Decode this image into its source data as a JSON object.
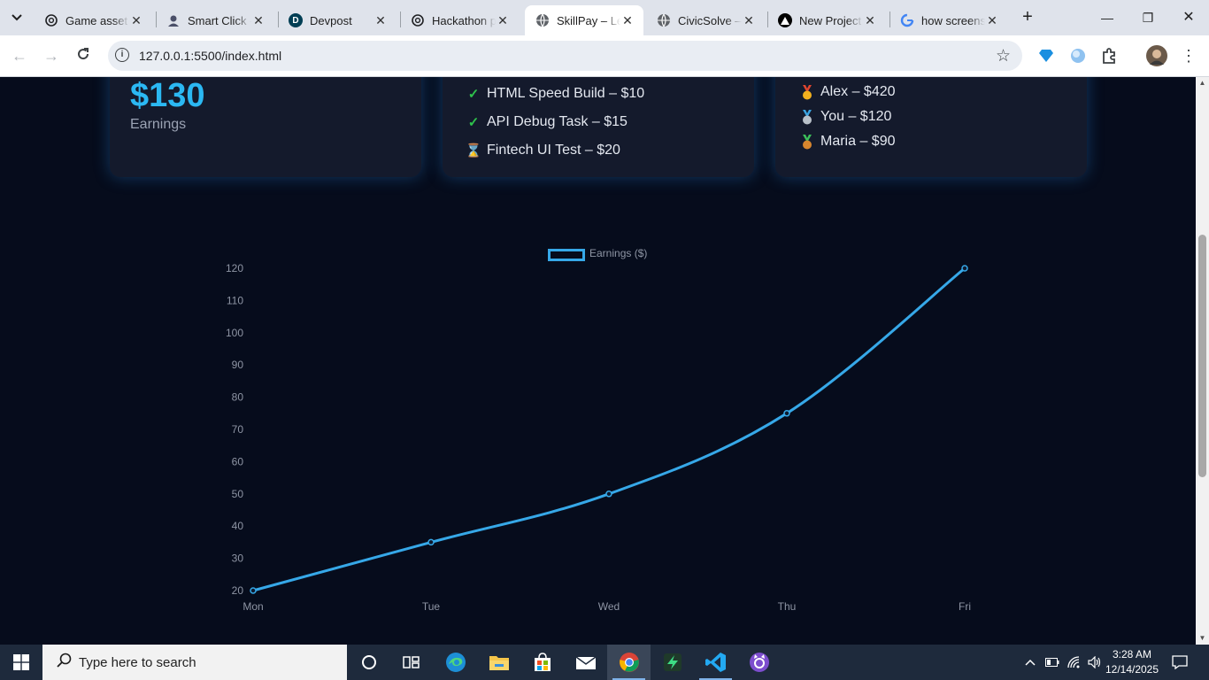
{
  "browser": {
    "tabs": [
      {
        "title": "Game asset generator",
        "icon": "openai-icon"
      },
      {
        "title": "Smart Click - ",
        "icon": "user-icon"
      },
      {
        "title": "Devpost",
        "icon": "devpost-icon"
      },
      {
        "title": "Hackathon project",
        "icon": "openai-icon"
      },
      {
        "title": "SkillPay – Learn",
        "icon": "globe-icon",
        "active": true
      },
      {
        "title": "CivicSolve — ",
        "icon": "globe-icon"
      },
      {
        "title": "New Project",
        "icon": "triangle-icon"
      },
      {
        "title": "how screenshot",
        "icon": "google-icon"
      }
    ],
    "url": "127.0.0.1:5500/index.html"
  },
  "page": {
    "earnings_card": {
      "amount": "$130",
      "label": "Earnings"
    },
    "tasks": [
      {
        "status": "done",
        "text": "HTML Speed Build – $10"
      },
      {
        "status": "done",
        "text": "API Debug Task – $15"
      },
      {
        "status": "pending",
        "text": "Fintech UI Test – $20"
      }
    ],
    "leaderboard": [
      {
        "medal": "gold",
        "text": "Alex – $420"
      },
      {
        "medal": "silver",
        "text": "You – $120"
      },
      {
        "medal": "bronze",
        "text": "Maria – $90"
      }
    ]
  },
  "chart_data": {
    "type": "line",
    "categories": [
      "Mon",
      "Tue",
      "Wed",
      "Thu",
      "Fri"
    ],
    "series": [
      {
        "name": "Earnings ($)",
        "values": [
          20,
          35,
          50,
          75,
          120
        ],
        "color": "#36a8e8"
      }
    ],
    "ylim": [
      20,
      120
    ],
    "yticks": [
      20,
      30,
      40,
      50,
      60,
      70,
      80,
      90,
      100,
      110,
      120
    ],
    "legend": "top",
    "grid": false
  },
  "taskbar": {
    "search_placeholder": "Type here to search",
    "time": "3:28 AM",
    "date": "12/14/2025"
  },
  "colors": {
    "accent": "#2bb8f3",
    "background": "#060c1c",
    "card": "#141a2c",
    "check": "#2ec24c"
  }
}
